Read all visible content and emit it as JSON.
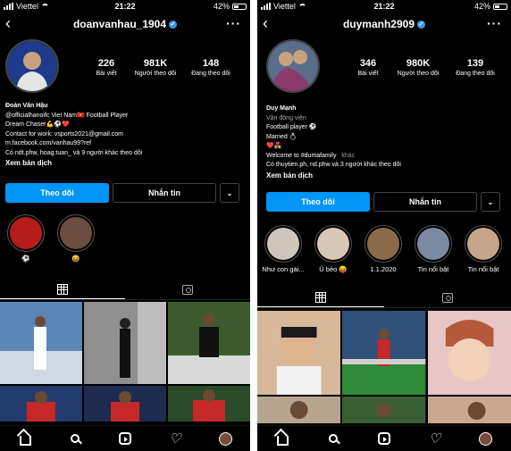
{
  "screens": [
    {
      "status": {
        "carrier": "Viettel",
        "time": "21:22",
        "battery": "42%"
      },
      "username": "doanvanhau_1904",
      "stats": [
        {
          "value": "226",
          "label": "Bài viết"
        },
        {
          "value": "981K",
          "label": "Người theo dõi"
        },
        {
          "value": "148",
          "label": "Đang theo dõi"
        }
      ],
      "bio": {
        "name": "Đoàn Văn Hậu",
        "lines": [
          "@officialhanoifc Viet Nam🇻🇳 Football Player",
          "Dream Chaser💪⚽❤️",
          "Contact for work: vsports2021@gmail.com",
          "m.facebook.com/vanhau99?ref"
        ],
        "followed_by": "Có ndt.phw, hoag.tuan_ và 9 người khác theo dõi",
        "translate": "Xem bản dịch"
      },
      "buttons": {
        "follow": "Theo dõi",
        "message": "Nhắn tin",
        "dropdown": "⌄"
      },
      "highlights": [
        {
          "label": "⚽",
          "color": "#b71c1c"
        },
        {
          "label": "😝",
          "color": "#6d4c41"
        }
      ],
      "photos": [
        "#5b86b8",
        "#7a7a7a",
        "#3d5a2f",
        "#b52626",
        "#233b6e",
        "#8c2020"
      ]
    },
    {
      "status": {
        "carrier": "Viettel",
        "time": "21:22",
        "battery": "42%"
      },
      "username": "duymanh2909",
      "stats": [
        {
          "value": "346",
          "label": "Bài viết"
        },
        {
          "value": "980K",
          "label": "Người theo dõi"
        },
        {
          "value": "139",
          "label": "Đang theo dõi"
        }
      ],
      "bio": {
        "name": "Duy Mạnh",
        "lines": [
          "Vận động viên",
          "Football player ⚽",
          "Married 💍",
          "❤️👩‍❤️‍👨",
          "Welcome to #dumafamily",
          "Có thuytien.ph, nd.phw và 3 người khác theo dõi"
        ],
        "more": "khác",
        "translate": "Xem bản dịch"
      },
      "buttons": {
        "follow": "Theo dõi",
        "message": "Nhắn tin",
        "dropdown": "⌄"
      },
      "highlights": [
        {
          "label": "Như con gái...",
          "color": "#cfc6bb"
        },
        {
          "label": "Ú béo 😝",
          "color": "#d9c7b5"
        },
        {
          "label": "1.1.2020",
          "color": "#8a6a4a"
        },
        {
          "label": "Tin nổi bật",
          "color": "#7a8aa0"
        },
        {
          "label": "Tin nổi bật",
          "color": "#c7a58a"
        }
      ],
      "photos": [
        "#d7b99a",
        "#2f6e3a",
        "#e8c6c6",
        "#b8a590",
        "#3a5f35",
        "#c9a891"
      ]
    }
  ]
}
